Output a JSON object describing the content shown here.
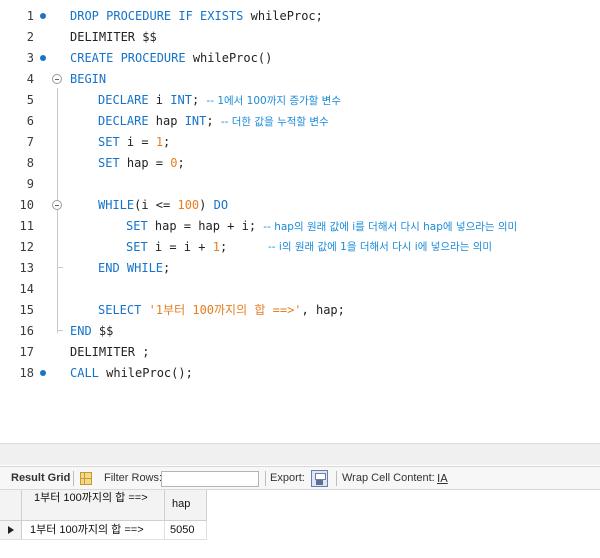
{
  "editor": {
    "lines": [
      {
        "n": "1",
        "dot": true
      },
      {
        "n": "2"
      },
      {
        "n": "3",
        "dot": true
      },
      {
        "n": "4"
      },
      {
        "n": "5"
      },
      {
        "n": "6"
      },
      {
        "n": "7"
      },
      {
        "n": "8"
      },
      {
        "n": "9"
      },
      {
        "n": "10"
      },
      {
        "n": "11"
      },
      {
        "n": "12"
      },
      {
        "n": "13"
      },
      {
        "n": "14"
      },
      {
        "n": "15"
      },
      {
        "n": "16"
      },
      {
        "n": "17"
      },
      {
        "n": "18",
        "dot": true
      }
    ],
    "code": {
      "l1_kw": "DROP PROCEDURE IF EXISTS",
      "l1_rest": " whileProc;",
      "l2": "DELIMITER $$",
      "l3_kw": "CREATE PROCEDURE",
      "l3_rest": " whileProc()",
      "l4_kw": "BEGIN",
      "l5_kw": "DECLARE",
      "l5_mid": " i ",
      "l5_kw2": "INT",
      "l5_semi": "; ",
      "l5_cm": "-- 1에서 100까지 증가할 변수",
      "l6_kw": "DECLARE",
      "l6_mid": " hap ",
      "l6_kw2": "INT",
      "l6_semi": "; ",
      "l6_cm": "-- 더한 값을 누적할 변수",
      "l7_kw": "SET",
      "l7_mid": " i = ",
      "l7_num": "1",
      "l7_end": ";",
      "l8_kw": "SET",
      "l8_mid": " hap = ",
      "l8_num": "0",
      "l8_end": ";",
      "l10_kw": "WHILE",
      "l10_mid": "(i <= ",
      "l10_num": "100",
      "l10_close": ") ",
      "l10_kw2": "DO",
      "l11_kw": "SET",
      "l11_mid": " hap = hap + i; ",
      "l11_cm": "-- hap의 원래 값에 i를 더해서 다시 hap에 넣으라는 의미",
      "l12_kw": "SET",
      "l12_mid": " i = i + ",
      "l12_num": "1",
      "l12_end": ";",
      "l12_cm": "-- i의 원래 값에 1을 더해서 다시 i에 넣으라는 의미",
      "l13_kw": "END WHILE",
      "l13_end": ";",
      "l15_kw": "SELECT",
      "l15_str": " '1부터 100까지의 합 ==>'",
      "l15_rest": ", hap;",
      "l16_kw": "END",
      "l16_rest": " $$",
      "l17": "DELIMITER ;",
      "l18_kw": "CALL",
      "l18_rest": " whileProc();"
    }
  },
  "toolbar": {
    "result_grid": "Result Grid",
    "filter_rows": "Filter Rows:",
    "filter_value": "",
    "export": "Export:",
    "wrap_cell_content": "Wrap Cell Content:",
    "wrap_icon_glyph": "IA"
  },
  "result": {
    "columns": [
      "1부터 100까지의 합 ==>",
      "hap"
    ],
    "rows": [
      [
        "1부터 100까지의 합 ==>",
        "5050"
      ]
    ]
  },
  "colors": {
    "keyword": "#1573c9",
    "number": "#e67e22",
    "comment": "#1a8ad8",
    "breakpoint_dot": "#1a73c8"
  }
}
